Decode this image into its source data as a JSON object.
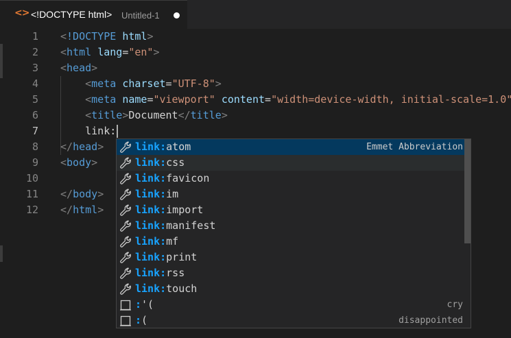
{
  "tab": {
    "icon": "<>",
    "title": "<!DOCTYPE html>",
    "description": "Untitled-1"
  },
  "editor": {
    "line_numbers": [
      "1",
      "2",
      "3",
      "4",
      "5",
      "6",
      "7",
      "8",
      "9",
      "10",
      "11",
      "12"
    ],
    "current_line": "7",
    "lines": [
      [
        {
          "c": "bracket",
          "t": "<"
        },
        {
          "c": "tag",
          "t": "!DOCTYPE"
        },
        {
          "c": "text",
          "t": " "
        },
        {
          "c": "attr",
          "t": "html"
        },
        {
          "c": "bracket",
          "t": ">"
        }
      ],
      [
        {
          "c": "bracket",
          "t": "<"
        },
        {
          "c": "tag",
          "t": "html"
        },
        {
          "c": "text",
          "t": " "
        },
        {
          "c": "attr",
          "t": "lang"
        },
        {
          "c": "text",
          "t": "="
        },
        {
          "c": "str",
          "t": "\"en\""
        },
        {
          "c": "bracket",
          "t": ">"
        }
      ],
      [
        {
          "c": "bracket",
          "t": "<"
        },
        {
          "c": "tag",
          "t": "head"
        },
        {
          "c": "bracket",
          "t": ">"
        }
      ],
      [
        {
          "c": "text",
          "t": "    "
        },
        {
          "c": "bracket",
          "t": "<"
        },
        {
          "c": "tag",
          "t": "meta"
        },
        {
          "c": "text",
          "t": " "
        },
        {
          "c": "attr",
          "t": "charset"
        },
        {
          "c": "text",
          "t": "="
        },
        {
          "c": "str",
          "t": "\"UTF-8\""
        },
        {
          "c": "bracket",
          "t": ">"
        }
      ],
      [
        {
          "c": "text",
          "t": "    "
        },
        {
          "c": "bracket",
          "t": "<"
        },
        {
          "c": "tag",
          "t": "meta"
        },
        {
          "c": "text",
          "t": " "
        },
        {
          "c": "attr",
          "t": "name"
        },
        {
          "c": "text",
          "t": "="
        },
        {
          "c": "str",
          "t": "\"viewport\""
        },
        {
          "c": "text",
          "t": " "
        },
        {
          "c": "attr",
          "t": "content"
        },
        {
          "c": "text",
          "t": "="
        },
        {
          "c": "str",
          "t": "\"width=device-width, initial-scale=1.0\""
        },
        {
          "c": "bracket",
          "t": ">"
        }
      ],
      [
        {
          "c": "text",
          "t": "    "
        },
        {
          "c": "bracket",
          "t": "<"
        },
        {
          "c": "tag",
          "t": "title"
        },
        {
          "c": "bracket",
          "t": ">"
        },
        {
          "c": "text",
          "t": "Document"
        },
        {
          "c": "bracket",
          "t": "</"
        },
        {
          "c": "tag",
          "t": "title"
        },
        {
          "c": "bracket",
          "t": ">"
        }
      ],
      [
        {
          "c": "text",
          "t": "    link:"
        }
      ],
      [
        {
          "c": "bracket",
          "t": "</"
        },
        {
          "c": "tag",
          "t": "head"
        },
        {
          "c": "bracket",
          "t": ">"
        }
      ],
      [
        {
          "c": "bracket",
          "t": "<"
        },
        {
          "c": "tag",
          "t": "body"
        },
        {
          "c": "bracket",
          "t": ">"
        }
      ],
      [],
      [
        {
          "c": "bracket",
          "t": "</"
        },
        {
          "c": "tag",
          "t": "body"
        },
        {
          "c": "bracket",
          "t": ">"
        }
      ],
      [
        {
          "c": "bracket",
          "t": "</"
        },
        {
          "c": "tag",
          "t": "html"
        },
        {
          "c": "bracket",
          "t": ">"
        }
      ]
    ]
  },
  "suggest": {
    "items": [
      {
        "icon": "wrench-icon",
        "match": "link:",
        "rest": "atom",
        "detail": "Emmet Abbreviation",
        "state": "selected"
      },
      {
        "icon": "wrench-icon",
        "match": "link:",
        "rest": "css",
        "detail": "",
        "state": "focused"
      },
      {
        "icon": "wrench-icon",
        "match": "link:",
        "rest": "favicon",
        "detail": "",
        "state": ""
      },
      {
        "icon": "wrench-icon",
        "match": "link:",
        "rest": "im",
        "detail": "",
        "state": ""
      },
      {
        "icon": "wrench-icon",
        "match": "link:",
        "rest": "import",
        "detail": "",
        "state": ""
      },
      {
        "icon": "wrench-icon",
        "match": "link:",
        "rest": "manifest",
        "detail": "",
        "state": ""
      },
      {
        "icon": "wrench-icon",
        "match": "link:",
        "rest": "mf",
        "detail": "",
        "state": ""
      },
      {
        "icon": "wrench-icon",
        "match": "link:",
        "rest": "print",
        "detail": "",
        "state": ""
      },
      {
        "icon": "wrench-icon",
        "match": "link:",
        "rest": "rss",
        "detail": "",
        "state": ""
      },
      {
        "icon": "wrench-icon",
        "match": "link:",
        "rest": "touch",
        "detail": "",
        "state": ""
      },
      {
        "icon": "snippet-icon",
        "match": ":",
        "rest": "'(",
        "detail": "cry",
        "state": ""
      },
      {
        "icon": "snippet-icon",
        "match": ":",
        "rest": "(",
        "detail": "disappointed",
        "state": ""
      }
    ]
  },
  "colors": {
    "background": "#1e1e1e",
    "tag": "#569cd6",
    "attribute": "#9cdcfe",
    "string": "#ce9178",
    "match_highlight": "#18a3ff",
    "selected_row": "#04395e"
  }
}
